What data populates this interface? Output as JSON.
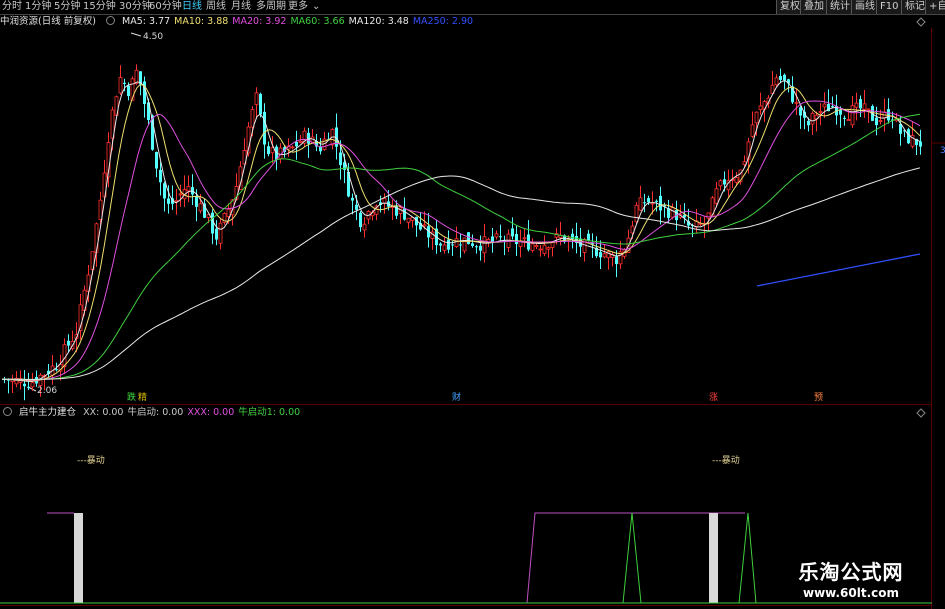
{
  "toolbar": {
    "timeframes": [
      "分时",
      "1分钟",
      "5分钟",
      "15分钟",
      "30分钟",
      "60分钟",
      "日线",
      "周线",
      "月线",
      "多周期",
      "更多"
    ],
    "active": "日线",
    "right_buttons": [
      "复权",
      "叠加",
      "统计",
      "画线",
      "F10",
      "标记",
      "+自"
    ]
  },
  "main_legend": {
    "stock": "中润资源(日线 前复权)",
    "ma": [
      {
        "label": "MA5: 3.77",
        "color": "#e8e8e8"
      },
      {
        "label": "MA10: 3.88",
        "color": "#f0e070"
      },
      {
        "label": "MA20: 3.92",
        "color": "#e050e0"
      },
      {
        "label": "MA60: 3.66",
        "color": "#40d040"
      },
      {
        "label": "MA120: 3.48",
        "color": "#e8e8e8"
      },
      {
        "label": "MA250: 2.90",
        "color": "#3050ff"
      }
    ]
  },
  "price_labels": {
    "high": "4.50",
    "low": "2.06"
  },
  "markers": [
    {
      "text": "跌",
      "color": "#40e040"
    },
    {
      "text": "精",
      "color": "#e0c000"
    },
    {
      "text": "财",
      "color": "#40a0ff"
    },
    {
      "text": "涨",
      "color": "#ff4040"
    },
    {
      "text": "预",
      "color": "#ff8040"
    }
  ],
  "indicator_legend": {
    "name": "启牛主力建仓",
    "items": [
      {
        "label": "XX: 0.00",
        "color": "#c8c8c8"
      },
      {
        "label": "牛启动: 0.00",
        "color": "#c8c8c8"
      },
      {
        "label": "XXX: 0.00",
        "color": "#e050e0"
      },
      {
        "label": "牛启动1: 0.00",
        "color": "#40d040"
      }
    ],
    "annotation": "---暴动"
  },
  "watermark": {
    "line1": "乐淘公式网",
    "line2": "www.60lt.com"
  },
  "chart_data": [
    {
      "type": "candlestick",
      "title": "中润资源(日线 前复权)",
      "series": [
        {
          "name": "MA5",
          "last": 3.77
        },
        {
          "name": "MA10",
          "last": 3.88
        },
        {
          "name": "MA20",
          "last": 3.92
        },
        {
          "name": "MA60",
          "last": 3.66
        },
        {
          "name": "MA120",
          "last": 3.48
        },
        {
          "name": "MA250",
          "last": 2.9
        }
      ],
      "annotations": [
        "4.50",
        "2.06"
      ]
    },
    {
      "type": "line",
      "title": "启牛主力建仓",
      "series": [
        {
          "name": "XX",
          "last": 0.0
        },
        {
          "name": "牛启动",
          "last": 0.0
        },
        {
          "name": "XXX",
          "last": 0.0
        },
        {
          "name": "牛启动1",
          "last": 0.0
        }
      ]
    }
  ]
}
